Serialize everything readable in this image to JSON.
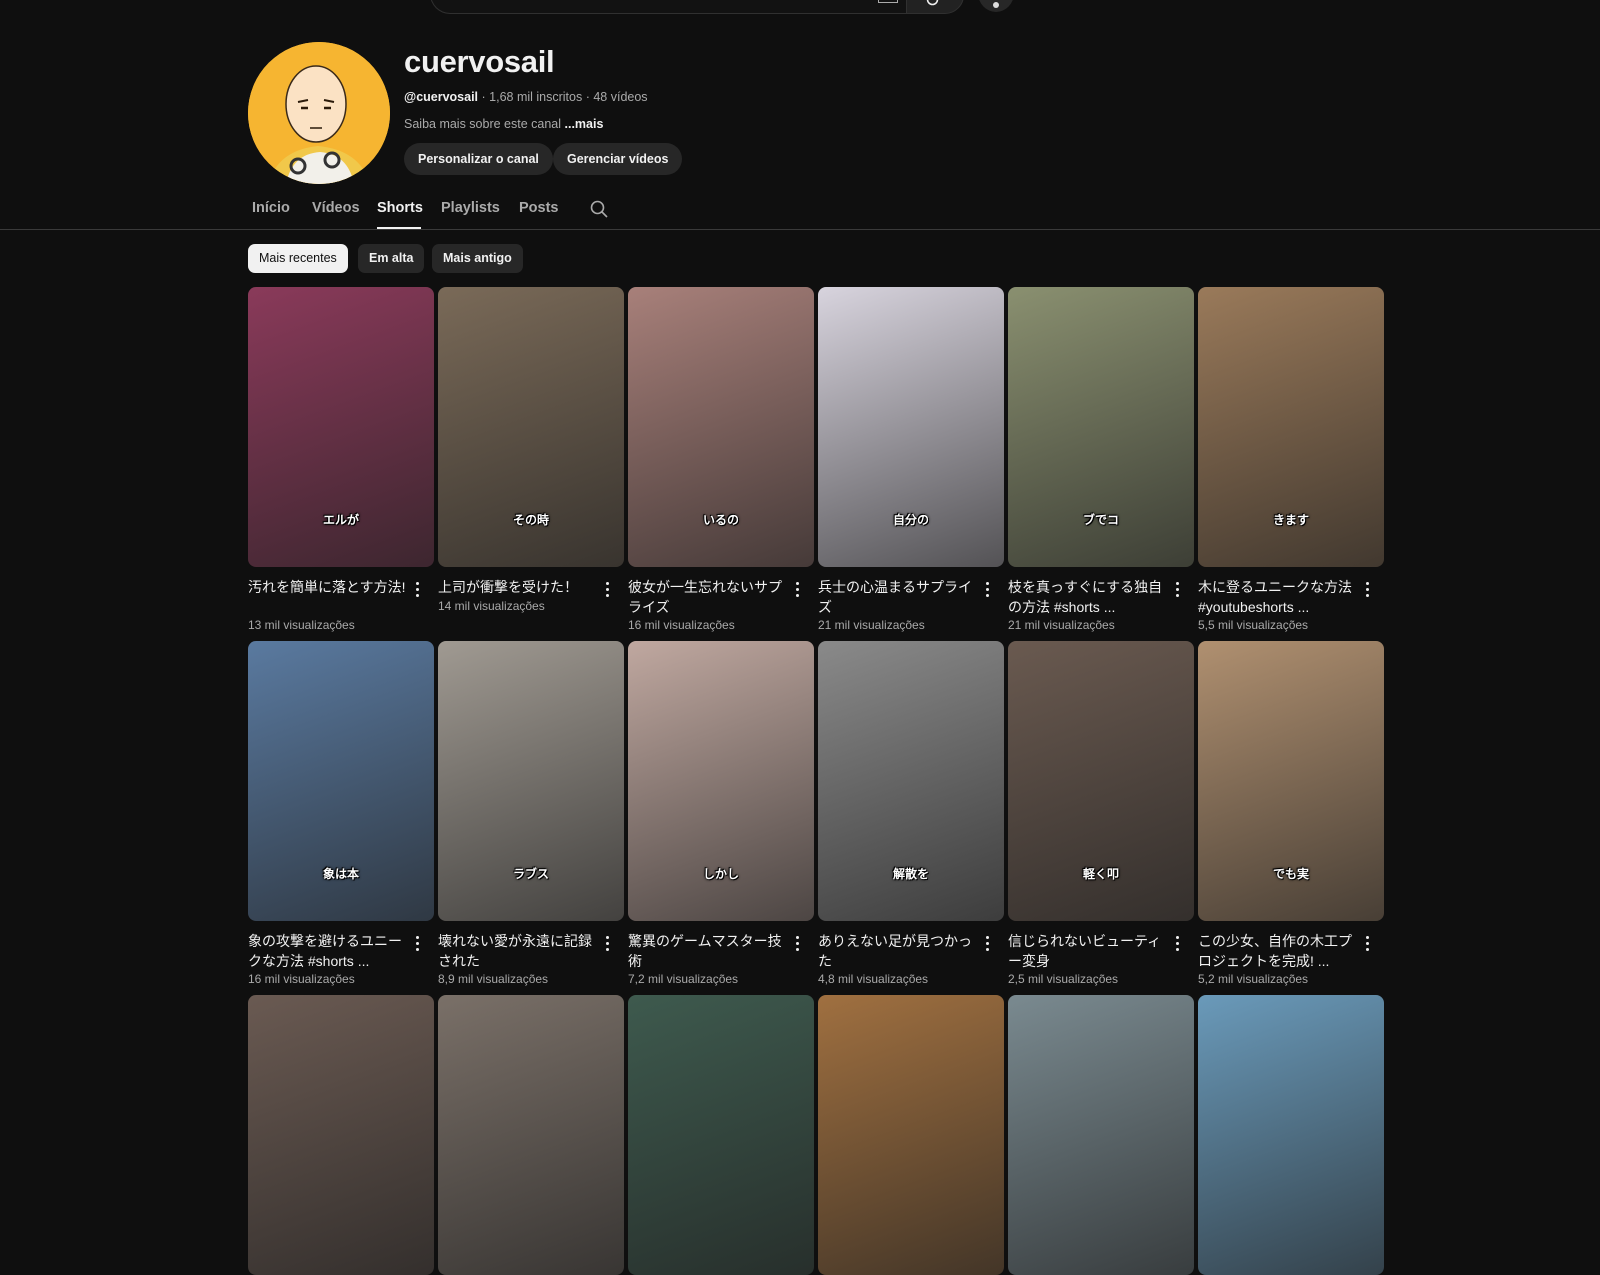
{
  "channel": {
    "name": "cuervosail",
    "handle": "@cuervosail",
    "stats": "· 1,68 mil inscritos · 48 vídeos",
    "about": "Saiba mais sobre este canal",
    "about_more": "...mais",
    "customize_label": "Personalizar o canal",
    "manage_label": "Gerenciar vídeos",
    "accent": "#f6b531"
  },
  "tabs": [
    {
      "label": "Início"
    },
    {
      "label": "Vídeos"
    },
    {
      "label": "Shorts",
      "active": true
    },
    {
      "label": "Playlists"
    },
    {
      "label": "Posts"
    }
  ],
  "chips": [
    {
      "label": "Mais recentes",
      "active": true
    },
    {
      "label": "Em alta"
    },
    {
      "label": "Mais antigo"
    }
  ],
  "shorts": [
    {
      "title": "汚れを簡単に落とす方法!",
      "views": "13 mil visualizações",
      "caption": "エルが",
      "color": "#8a3a5a"
    },
    {
      "title": "上司が衝撃を受けた！",
      "views": "14 mil visualizações",
      "caption": "その時",
      "color": "#7a6a58"
    },
    {
      "title": "彼女が一生忘れないサプライズ",
      "views": "16 mil visualizações",
      "caption": "いるの",
      "color": "#a8807a"
    },
    {
      "title": "兵士の心温まるサプライズ",
      "views": "21 mil visualizações",
      "caption": "自分の",
      "color": "#d8d4de"
    },
    {
      "title": "枝を真っすぐにする独自の方法 #shorts ...",
      "views": "21 mil visualizações",
      "caption": "ブでコ",
      "color": "#8a9070"
    },
    {
      "title": "木に登るユニークな方法 #youtubeshorts ...",
      "views": "5,5 mil visualizações",
      "caption": "きます",
      "color": "#9a7a5a"
    },
    {
      "title": "象の攻撃を避けるユニークな方法 #shorts ...",
      "views": "16 mil visualizações",
      "caption": "象は本",
      "color": "#5a7aa0"
    },
    {
      "title": "壊れない愛が永遠に記録された",
      "views": "8,9 mil visualizações",
      "caption": "ラブス",
      "color": "#a09a92"
    },
    {
      "title": "驚異のゲームマスター技術",
      "views": "7,2 mil visualizações",
      "caption": "しかし",
      "color": "#c0a8a0"
    },
    {
      "title": "ありえない足が見つかった",
      "views": "4,8 mil visualizações",
      "caption": "解散を",
      "color": "#8a8a8a"
    },
    {
      "title": "信じられないビューティー変身",
      "views": "2,5 mil visualizações",
      "caption": "軽く叩",
      "color": "#6a5a50"
    },
    {
      "title": "この少女、自作の木工プロジェクトを完成! ...",
      "views": "5,2 mil visualizações",
      "caption": "でも実",
      "color": "#b09070"
    },
    {
      "title": "",
      "views": "",
      "caption": "",
      "color": "#6a5a52"
    },
    {
      "title": "",
      "views": "",
      "caption": "",
      "color": "#7a7068"
    },
    {
      "title": "",
      "views": "",
      "caption": "",
      "color": "#3e5a4e"
    },
    {
      "title": "",
      "views": "",
      "caption": "",
      "color": "#a07040"
    },
    {
      "title": "",
      "views": "",
      "caption": "",
      "color": "#7a8a90"
    },
    {
      "title": "",
      "views": "",
      "caption": "",
      "color": "#6a9aba"
    }
  ]
}
